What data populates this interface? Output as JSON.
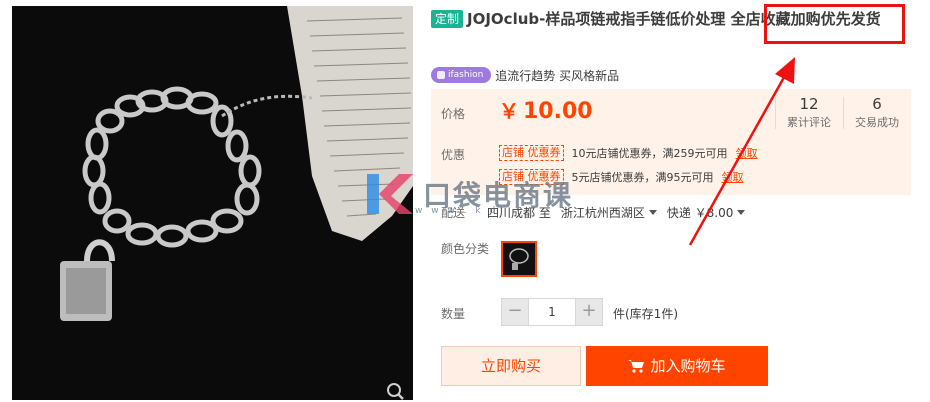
{
  "product": {
    "custom_tag": "定制",
    "title": "JOJOclub-样品项链戒指手链低价处理 全店收藏加购优先发货",
    "ifashion_badge": "ifashion",
    "slogan": "追流行趋势 买风格新品"
  },
  "price": {
    "label": "价格",
    "currency": "￥",
    "value": "10.00",
    "reviews_count": "12",
    "reviews_label": "累计评论",
    "sales_count": "6",
    "sales_label": "交易成功"
  },
  "coupons": {
    "label": "优惠",
    "items": [
      {
        "tag": "店铺 优惠券",
        "text": "10元店铺优惠券，满259元可用",
        "action": "领取"
      },
      {
        "tag": "店铺 优惠券",
        "text": "5元店铺优惠券，满95元可用",
        "action": "领取"
      }
    ]
  },
  "shipping": {
    "label": "配送",
    "from": "四川成都 至",
    "to": "浙江杭州西湖区",
    "method": "快递 ￥8.00"
  },
  "sku": {
    "color_label": "颜色分类"
  },
  "quantity": {
    "label": "数量",
    "minus": "−",
    "value": "1",
    "plus": "+",
    "stock": "件(库存1件)"
  },
  "actions": {
    "buy_now": "立即购买",
    "add_to_cart": "加入购物车"
  },
  "watermark": {
    "logo_letter": "K",
    "text": "口袋电商课",
    "url": "w w w . k d"
  },
  "colors": {
    "accent": "#ff4400",
    "annotation": "#ee1111",
    "price_panel": "#fff2e8",
    "tag_green": "#1ab394",
    "ifashion_purple": "#9c7adf"
  }
}
